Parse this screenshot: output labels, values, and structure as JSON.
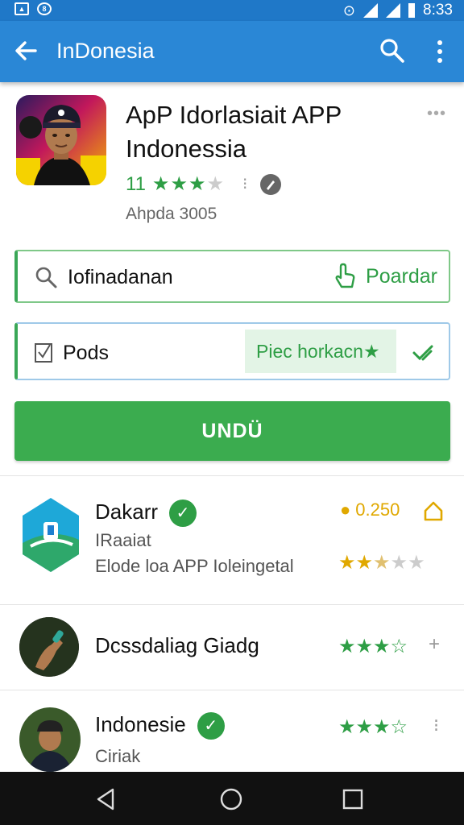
{
  "status_bar": {
    "time": "8:33"
  },
  "app_bar": {
    "title": "InDonesia"
  },
  "app": {
    "title": "ApP Idorlasiait APP Indonessia",
    "rating": "11",
    "developer": "Ahpda 3005"
  },
  "search_field": {
    "value": "Iofinadanan",
    "action_label": "Poardar"
  },
  "option_field": {
    "value": "Pods",
    "chip_label": "Piec horkacn"
  },
  "install_button": {
    "label": "UNDÜ"
  },
  "list": [
    {
      "name": "Dakarr",
      "line1": "IRaaiat",
      "line2": "Elode loa APP Ioleingetal",
      "price": "0.250",
      "stars": 2.5
    },
    {
      "name": "Dcssdaliag Giadg",
      "stars": 3
    },
    {
      "name": "Indonesie",
      "line1": "Ciriak",
      "stars": 3
    }
  ],
  "colors": {
    "accent_green": "#2e9e45",
    "app_bar_blue": "#2a87d6",
    "status_bar_blue": "#1f78c8",
    "gold": "#e0a800"
  }
}
